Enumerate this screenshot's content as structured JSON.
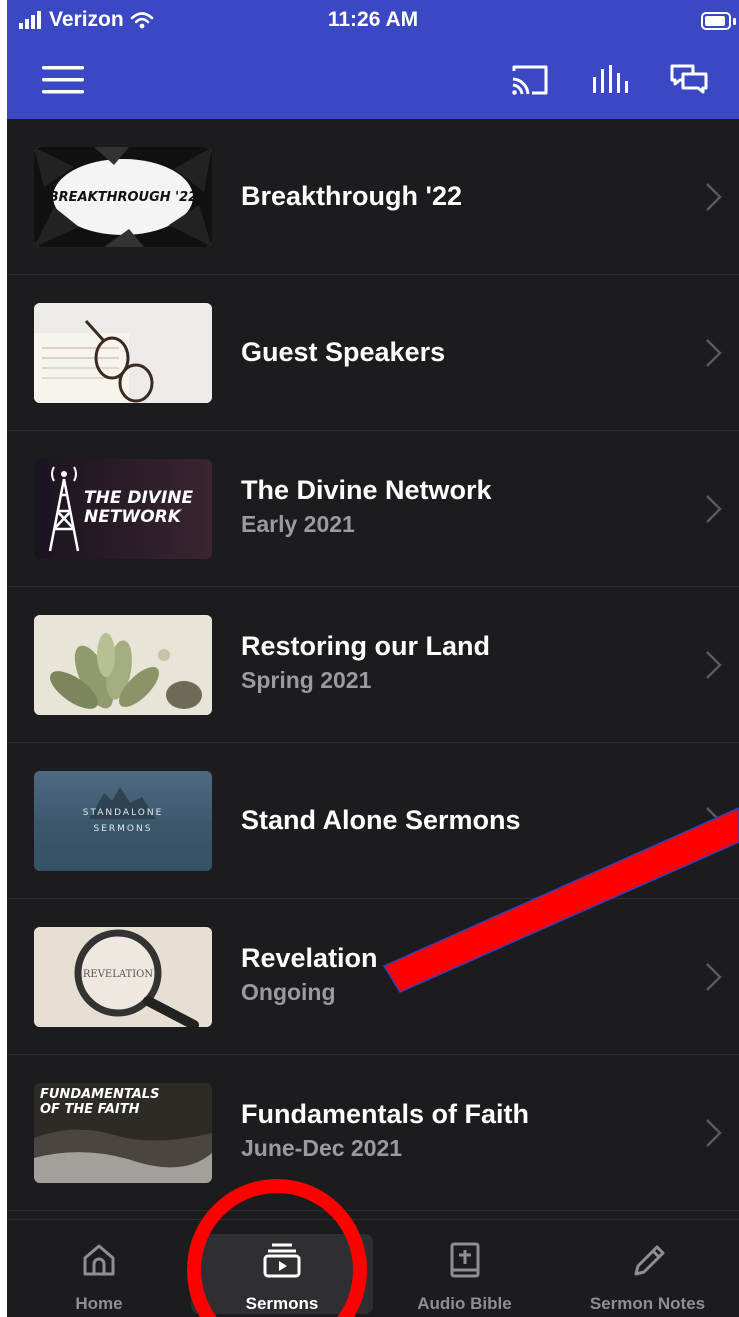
{
  "status_bar": {
    "carrier": "Verizon",
    "time": "11:26 AM"
  },
  "header": {
    "icons": [
      "menu-icon",
      "cast-icon",
      "audio-bars-icon",
      "chat-icon"
    ]
  },
  "series": [
    {
      "title": "Breakthrough '22",
      "subtitle": "",
      "thumb_text": "BREAKTHROUGH '22"
    },
    {
      "title": "Guest Speakers",
      "subtitle": "",
      "thumb_text": ""
    },
    {
      "title": "The Divine Network",
      "subtitle": "Early 2021",
      "thumb_text": "THE DIVINE NETWORK"
    },
    {
      "title": "Restoring our Land",
      "subtitle": "Spring 2021",
      "thumb_text": ""
    },
    {
      "title": "Stand Alone Sermons",
      "subtitle": "",
      "thumb_text": "STANDALONE SERMONS"
    },
    {
      "title": "Revelation",
      "subtitle": "Ongoing",
      "thumb_text": "REVELATION"
    },
    {
      "title": "Fundamentals of Faith",
      "subtitle": "June-Dec 2021",
      "thumb_text": "FUNDAMENTALS OF THE FAITH"
    }
  ],
  "tabs": [
    {
      "label": "Home",
      "icon": "home-icon",
      "active": false
    },
    {
      "label": "Sermons",
      "icon": "sermons-icon",
      "active": true
    },
    {
      "label": "Audio Bible",
      "icon": "bible-icon",
      "active": false
    },
    {
      "label": "Sermon Notes",
      "icon": "pencil-icon",
      "active": false
    }
  ],
  "colors": {
    "header": "#3b48c4",
    "background": "#1c1c1e",
    "annotation": "#ff0000"
  }
}
